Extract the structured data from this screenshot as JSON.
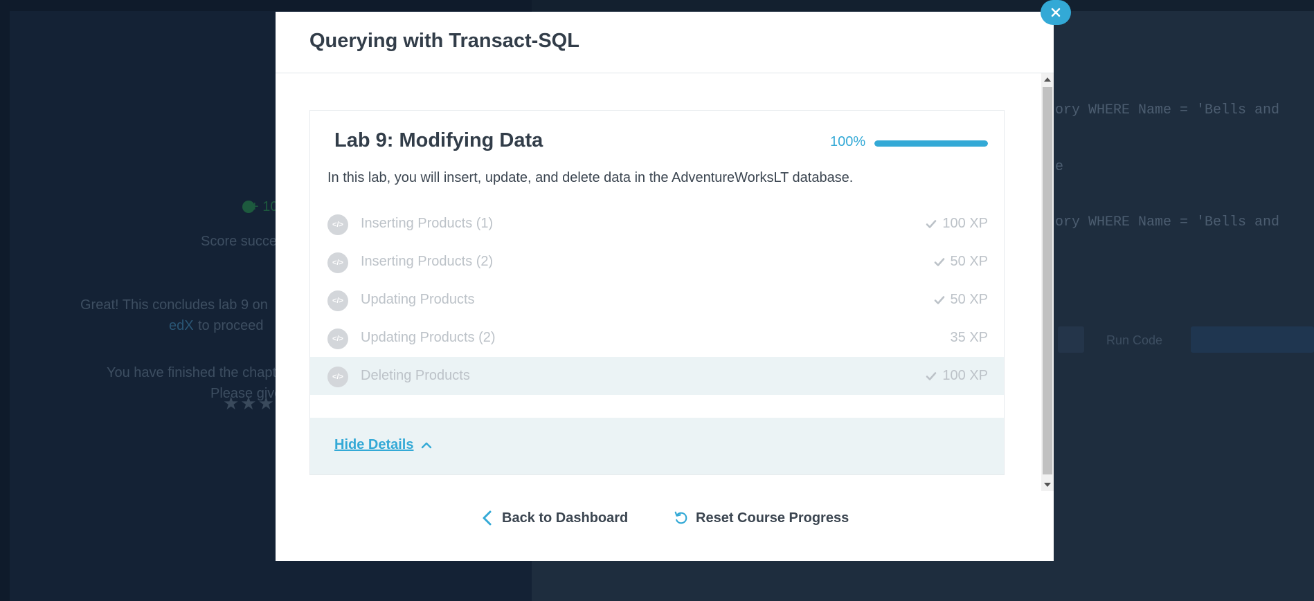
{
  "background": {
    "texts": [
      "+ 10",
      "Score succe",
      "Great! This concludes lab 9 on",
      "edX",
      "to proceed",
      "You have finished the chapte",
      "Please give"
    ],
    "code_lines": [
      "ory WHERE Name = 'Bells and",
      "e",
      "ory WHERE Name = 'Bells and"
    ],
    "buttons": [
      "Run Code"
    ]
  },
  "modal": {
    "title": "Querying with Transact-SQL",
    "close_label": "×"
  },
  "lab": {
    "title": "Lab 9: Modifying Data",
    "progress_label": "100%",
    "progress": 1.0,
    "description": "In this lab, you will insert, update, and delete data in the AdventureWorksLT database.",
    "exercises": [
      {
        "name": "Inserting Products (1)",
        "xp": "100 XP",
        "completed": true,
        "icon": "code-icon"
      },
      {
        "name": "Inserting Products (2)",
        "xp": "50 XP",
        "completed": true,
        "icon": "code-icon"
      },
      {
        "name": "Updating Products",
        "xp": "50 XP",
        "completed": true,
        "icon": "code-icon"
      },
      {
        "name": "Updating Products (2)",
        "xp": "35 XP",
        "completed": false,
        "icon": "code-icon"
      },
      {
        "name": "Deleting Products",
        "xp": "100 XP",
        "completed": true,
        "icon": "code-icon",
        "active": true
      }
    ],
    "hide_details": "Hide Details"
  },
  "footer": {
    "back": "Back to Dashboard",
    "reset": "Reset Course Progress"
  },
  "colors": {
    "accent": "#33a9d6",
    "overlay": "#1c2a3a"
  }
}
